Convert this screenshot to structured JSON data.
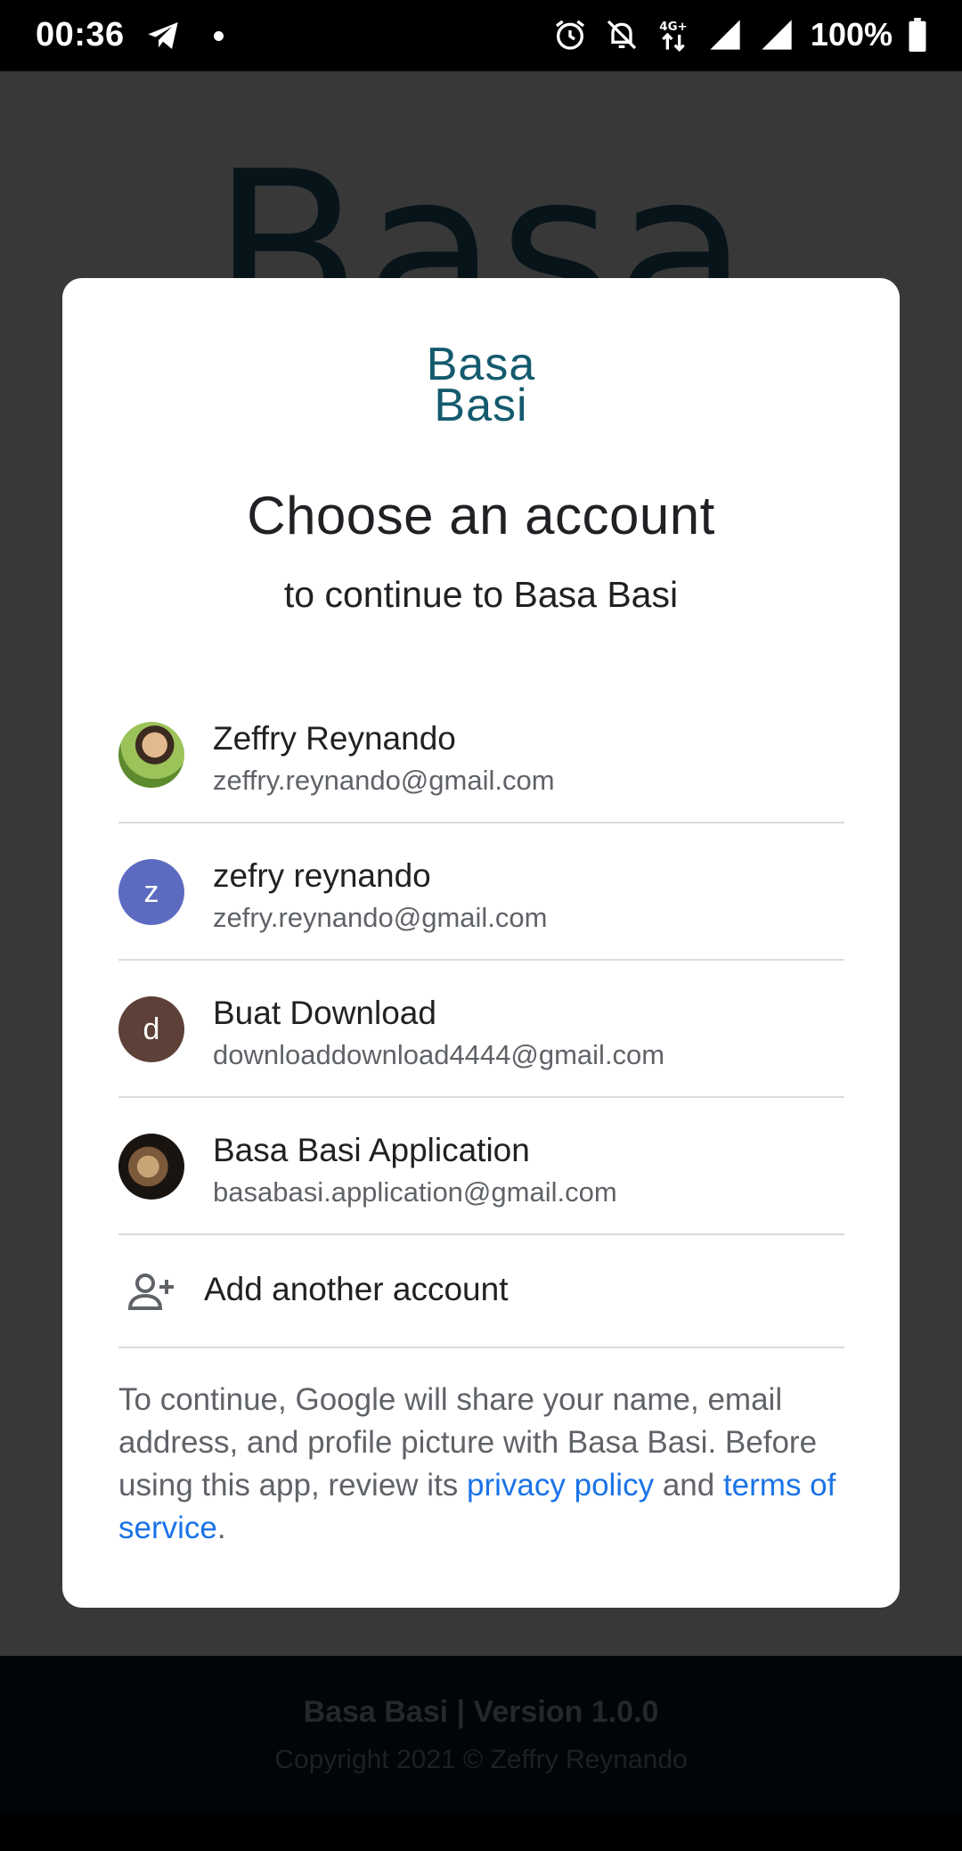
{
  "status_bar": {
    "time": "00:36",
    "icons": [
      "telegram-icon",
      "notification-dot",
      "alarm-icon",
      "notifications-off-icon",
      "network-4g-icon",
      "signal-icon",
      "signal-icon",
      "battery-icon"
    ],
    "network_label": "4G+",
    "battery": "100%"
  },
  "background_app": {
    "logo_text": "Basa",
    "footer_version": "Basa Basi | Version 1.0.0",
    "footer_copyright": "Copyright 2021 © Zeffry Reynando"
  },
  "dialog": {
    "brand_line1": "Basa",
    "brand_line2": "Basi",
    "title": "Choose an account",
    "subtitle": "to continue to Basa Basi",
    "accounts": [
      {
        "name": "Zeffry Reynando",
        "email": "zeffry.reynando@gmail.com",
        "avatar": "photo"
      },
      {
        "name": "zefry reynando",
        "email": "zefry.reynando@gmail.com",
        "avatar_letter": "z",
        "avatar_color": "#5c6bc0"
      },
      {
        "name": "Buat Download",
        "email": "downloaddownload4444@gmail.com",
        "avatar_letter": "d",
        "avatar_color": "#5d4037"
      },
      {
        "name": "Basa Basi Application",
        "email": "basabasi.application@gmail.com",
        "avatar": "photo"
      }
    ],
    "add_account_label": "Add another account",
    "consent": {
      "part1": "To continue, Google will share your name, email address, and profile picture with Basa Basi. Before using this app, review its ",
      "privacy_link": "privacy policy",
      "part2": " and ",
      "terms_link": "terms of service",
      "part3": "."
    }
  },
  "colors": {
    "link": "#1a73e8",
    "brand": "#145a6e",
    "scrim": "#383838"
  }
}
